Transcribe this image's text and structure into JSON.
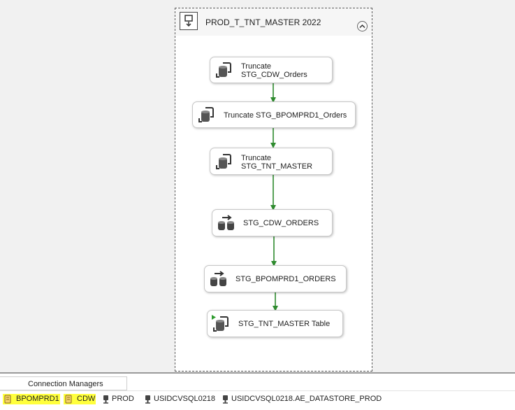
{
  "container": {
    "title": "PROD_T_TNT_MASTER 2022",
    "icon": "sequence-container-icon",
    "collapse_icon": "collapse-chevron-icon"
  },
  "tasks": [
    {
      "line1": "Truncate",
      "line2": "STG_CDW_Orders",
      "icon": "execute-sql-task-icon"
    },
    {
      "line1": "Truncate STG_BPOMPRD1_Orders",
      "line2": "",
      "icon": "execute-sql-task-icon"
    },
    {
      "line1": "Truncate",
      "line2": "STG_TNT_MASTER",
      "icon": "execute-sql-task-icon"
    },
    {
      "line1": "STG_CDW_ORDERS",
      "line2": "",
      "icon": "data-flow-task-icon"
    },
    {
      "line1": "STG_BPOMPRD1_ORDERS",
      "line2": "",
      "icon": "data-flow-task-icon"
    },
    {
      "line1": "STG_TNT_MASTER Table",
      "line2": "",
      "icon": "execute-sql-task-play-icon"
    }
  ],
  "connection_managers": {
    "tab_label": "Connection Managers",
    "items": [
      {
        "label": "BPOMPRD1",
        "icon": "file-connection-icon",
        "highlighted": true
      },
      {
        "label": "CDW",
        "icon": "file-connection-icon",
        "highlighted": true
      },
      {
        "label": "PROD",
        "icon": "oledb-connection-icon",
        "highlighted": false
      },
      {
        "label": "USIDCVSQL0218",
        "icon": "oledb-connection-icon",
        "highlighted": false
      },
      {
        "label": "USIDCVSQL0218.AE_DATASTORE_PROD",
        "icon": "oledb-connection-icon",
        "highlighted": false
      }
    ]
  },
  "colors": {
    "precedence_success": "#2e8b2e",
    "highlight": "#ffff3c",
    "border": "#5a5a5a"
  }
}
